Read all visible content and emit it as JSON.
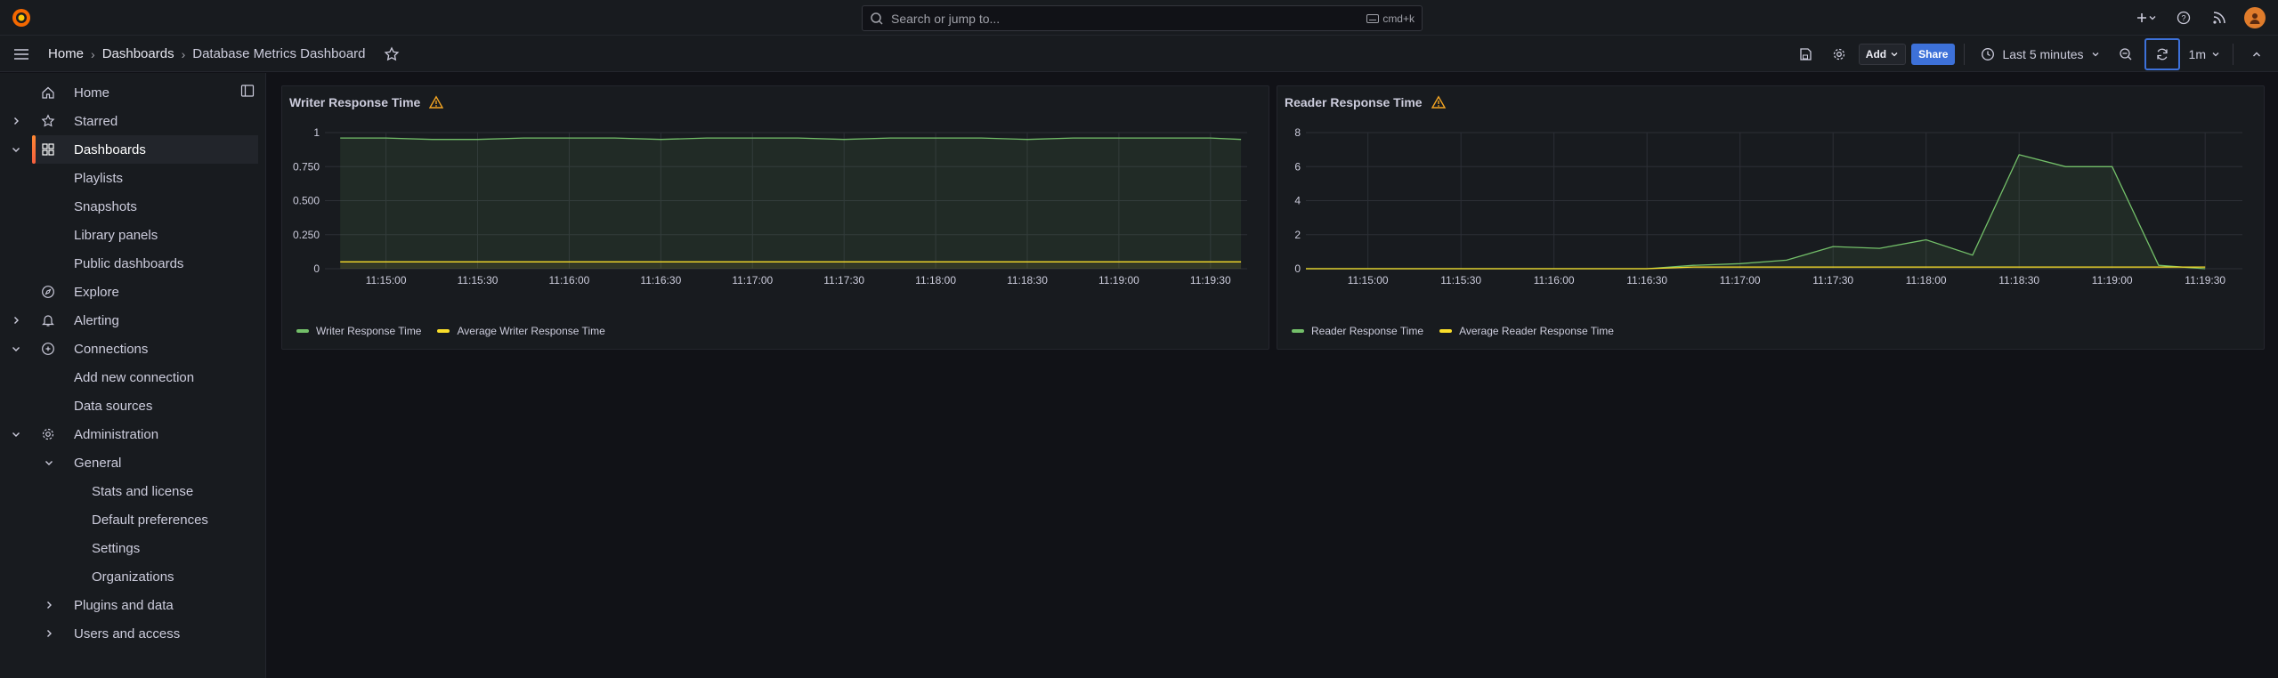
{
  "topbar": {
    "search_placeholder": "Search or jump to...",
    "search_shortcut": "cmd+k"
  },
  "breadcrumbs": [
    {
      "label": "Home"
    },
    {
      "label": "Dashboards"
    },
    {
      "label": "Database Metrics Dashboard"
    }
  ],
  "toolbar": {
    "add_label": "Add",
    "share_label": "Share",
    "time_range": "Last 5 minutes",
    "refresh_interval": "1m"
  },
  "sidebar": {
    "items": [
      {
        "label": "Home",
        "icon": "home-icon"
      },
      {
        "label": "Starred",
        "icon": "star-icon"
      },
      {
        "label": "Dashboards",
        "icon": "dashboards-icon"
      },
      {
        "label": "Playlists"
      },
      {
        "label": "Snapshots"
      },
      {
        "label": "Library panels"
      },
      {
        "label": "Public dashboards"
      },
      {
        "label": "Explore",
        "icon": "compass-icon"
      },
      {
        "label": "Alerting",
        "icon": "bell-icon"
      },
      {
        "label": "Connections",
        "icon": "connections-icon"
      },
      {
        "label": "Add new connection"
      },
      {
        "label": "Data sources"
      },
      {
        "label": "Administration",
        "icon": "cog-icon"
      },
      {
        "label": "General"
      },
      {
        "label": "Stats and license"
      },
      {
        "label": "Default preferences"
      },
      {
        "label": "Settings"
      },
      {
        "label": "Organizations"
      },
      {
        "label": "Plugins and data"
      },
      {
        "label": "Users and access"
      }
    ]
  },
  "colors": {
    "series_green": "#73bf69",
    "series_yellow": "#fade2a",
    "accent_blue": "#3d71d9",
    "warning_orange": "#f5a623"
  },
  "chart_data": [
    {
      "type": "area",
      "title": "Writer Response Time",
      "x": [
        "11:14:45",
        "11:15:00",
        "11:15:15",
        "11:15:30",
        "11:15:45",
        "11:16:00",
        "11:16:15",
        "11:16:30",
        "11:16:45",
        "11:17:00",
        "11:17:15",
        "11:17:30",
        "11:17:45",
        "11:18:00",
        "11:18:15",
        "11:18:30",
        "11:18:45",
        "11:19:00",
        "11:19:15",
        "11:19:30",
        "11:19:40"
      ],
      "x_ticks": [
        "11:15:00",
        "11:15:30",
        "11:16:00",
        "11:16:30",
        "11:17:00",
        "11:17:30",
        "11:18:00",
        "11:18:30",
        "11:19:00",
        "11:19:30"
      ],
      "y_ticks": [
        "0",
        "0.250",
        "0.500",
        "0.750",
        "1"
      ],
      "ylim": [
        0,
        1
      ],
      "series": [
        {
          "name": "Writer Response Time",
          "values": [
            0.96,
            0.96,
            0.95,
            0.95,
            0.96,
            0.96,
            0.96,
            0.95,
            0.96,
            0.96,
            0.96,
            0.95,
            0.96,
            0.96,
            0.96,
            0.95,
            0.96,
            0.96,
            0.96,
            0.96,
            0.95
          ]
        },
        {
          "name": "Average Writer Response Time",
          "values": [
            0.05,
            0.05,
            0.05,
            0.05,
            0.05,
            0.05,
            0.05,
            0.05,
            0.05,
            0.05,
            0.05,
            0.05,
            0.05,
            0.05,
            0.05,
            0.05,
            0.05,
            0.05,
            0.05,
            0.05,
            0.05
          ]
        }
      ],
      "grid": true,
      "legend": "bottom"
    },
    {
      "type": "area",
      "title": "Reader Response Time",
      "x": [
        "11:14:40",
        "11:16:30",
        "11:16:45",
        "11:17:00",
        "11:17:15",
        "11:17:30",
        "11:17:45",
        "11:18:00",
        "11:18:15",
        "11:18:30",
        "11:18:45",
        "11:19:00",
        "11:19:15",
        "11:19:30"
      ],
      "x_ticks": [
        "11:15:00",
        "11:15:30",
        "11:16:00",
        "11:16:30",
        "11:17:00",
        "11:17:30",
        "11:18:00",
        "11:18:30",
        "11:19:00",
        "11:19:30"
      ],
      "y_ticks": [
        "0",
        "2",
        "4",
        "6",
        "8"
      ],
      "ylim": [
        0,
        8
      ],
      "series": [
        {
          "name": "Reader Response Time",
          "values": [
            0,
            0,
            0.2,
            0.3,
            0.5,
            1.3,
            1.2,
            1.7,
            0.8,
            6.7,
            6.0,
            6.0,
            0.2,
            0
          ]
        },
        {
          "name": "Average Reader Response Time",
          "values": [
            0,
            0,
            0.1,
            0.1,
            0.1,
            0.1,
            0.1,
            0.1,
            0.1,
            0.1,
            0.1,
            0.1,
            0.1,
            0.1
          ]
        }
      ],
      "grid": true,
      "legend": "bottom"
    }
  ]
}
